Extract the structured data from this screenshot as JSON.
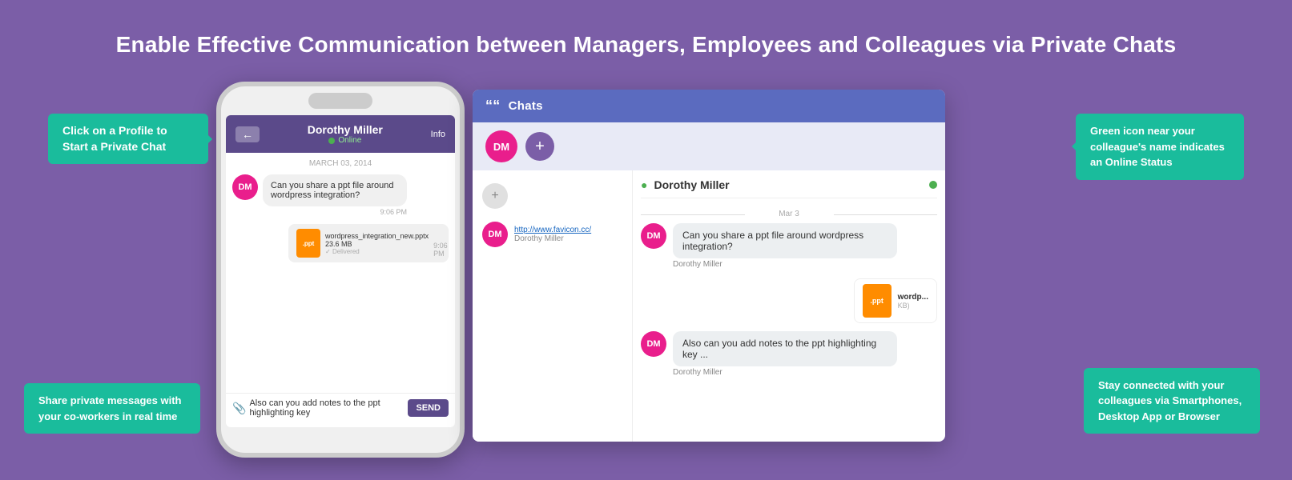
{
  "page": {
    "heading": "Enable Effective Communication between Managers, Employees and Colleagues via Private Chats",
    "bg_color": "#7B5EA7"
  },
  "tooltip_left_top": {
    "text": "Click on a Profile to Start a Private Chat"
  },
  "tooltip_left_bottom": {
    "text": "Share private messages with your co-workers in real time"
  },
  "tooltip_right_top": {
    "text": "Green icon near your colleague's name indicates an Online Status"
  },
  "tooltip_right_bottom": {
    "text": "Stay connected with your colleagues via Smartphones, Desktop App or Browser"
  },
  "phone": {
    "contact_name": "Dorothy Miller",
    "status": "Online",
    "info_label": "Info",
    "date_separator": "MARCH 03, 2014",
    "messages": [
      {
        "sender": "DM",
        "text": "Can you share a ppt file around wordpress integration?",
        "time": "9:06 PM"
      }
    ],
    "file": {
      "name": "wordpress_integration_new.pptx",
      "size": "23.6 MB",
      "status": "Delivered",
      "time": "9:06 PM"
    },
    "input_placeholder": "Also can you add notes to the ppt highlighting key",
    "send_label": "SEND"
  },
  "chat_panel": {
    "title": "Chats",
    "quote_icon": "““",
    "dm_avatar": "DM",
    "add_button": "+",
    "active_contact": "Dorothy Miller",
    "date_divider": "Mar 3",
    "message1": "Can you share a ppt file around wordpress integration?",
    "message1_sender": "Dorothy Miller",
    "message2": "Also can you add notes to the ppt highlighting key ...",
    "message2_sender": "Dorothy Miller",
    "list_item_link": "http://www.favicon.cc/",
    "list_item_name": "Dorothy Miller",
    "file": {
      "name": "wordp...",
      "ext": ".ppt",
      "size": "KB)"
    }
  }
}
